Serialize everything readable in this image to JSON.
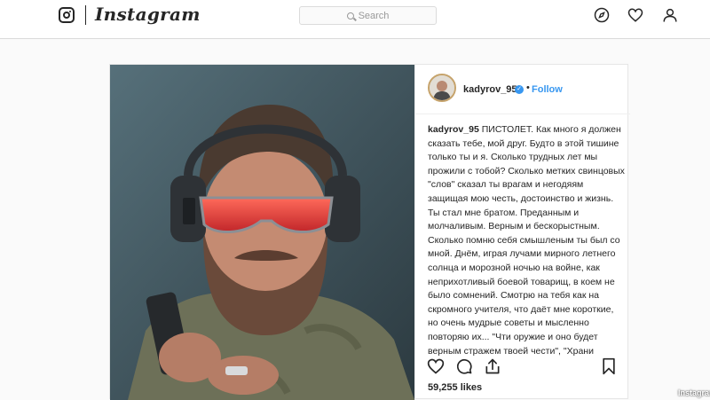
{
  "topbar": {
    "brand": "Instagram",
    "search_placeholder": "Search",
    "icons": [
      "instagram-camera-icon",
      "compass-icon",
      "heart-icon",
      "profile-icon"
    ]
  },
  "post": {
    "username": "kadyrov_95",
    "verified": true,
    "separator": "•",
    "follow_label": "Follow",
    "caption_user": "kadyrov_95",
    "caption_text": "ПИСТОЛЕТ. Как много я должен сказать тебе, мой друг. Будто в этой тишине только ты и я. Сколько трудных лет мы прожили с тобой? Сколько метких свинцовых \"слов\" сказал ты врагам и негодяям защищая мою честь, достоинство и жизнь. Ты стал мне братом. Преданным и молчаливым. Верным и бескорыстным. Сколько помню себя смышленым ты был со мной. Днём, играя лучами мирного летнего солнца и морозной ночью на войне, как неприхотливый боевой товарищ, в коем не было сомнений. Смотрю на тебя как на скромного учителя, что даёт мне короткие, но очень мудрые советы и мысленно повторяю их... \"Чти оружие и оно будет верным стражем твоей чести\", \"Храни оружие в чистоте и оно не запятнает твою совесть\", \"Если вынул",
    "likes": "59,255 likes",
    "action_icons": [
      "heart-icon",
      "comment-icon",
      "share-icon",
      "bookmark-icon"
    ]
  },
  "watermark": "Instagram",
  "colors": {
    "accent": "#3897f0",
    "border": "#dbdbdb",
    "background": "#fafafa"
  }
}
